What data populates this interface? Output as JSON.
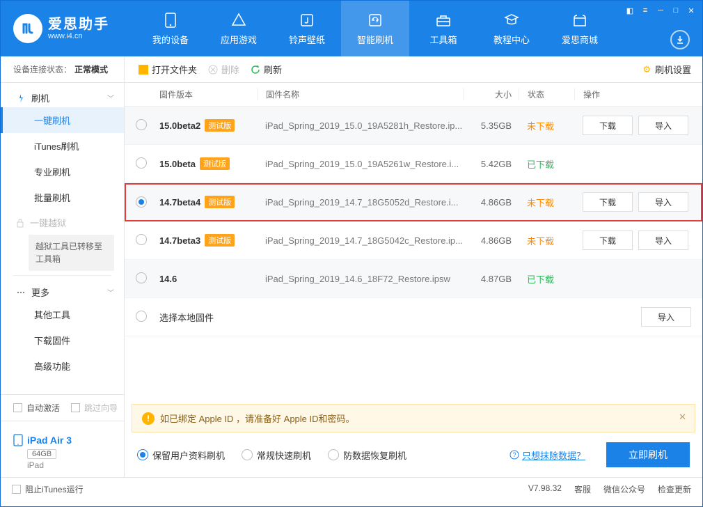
{
  "brand": {
    "name": "爱思助手",
    "url": "www.i4.cn"
  },
  "nav": [
    {
      "label": "我的设备"
    },
    {
      "label": "应用游戏"
    },
    {
      "label": "铃声壁纸"
    },
    {
      "label": "智能刷机"
    },
    {
      "label": "工具箱"
    },
    {
      "label": "教程中心"
    },
    {
      "label": "爱思商城"
    }
  ],
  "connection": {
    "prefix": "设备连接状态：",
    "mode": "正常模式"
  },
  "sidebar": {
    "flash_group": "刷机",
    "items": {
      "onekey": "一键刷机",
      "itunes": "iTunes刷机",
      "pro": "专业刷机",
      "batch": "批量刷机",
      "jailbreak": "一键越狱",
      "jailbreak_note": "越狱工具已转移至工具箱",
      "more_group": "更多",
      "other_tools": "其他工具",
      "download_fw": "下载固件",
      "advanced": "高级功能"
    }
  },
  "toolbar": {
    "open": "打开文件夹",
    "delete": "删除",
    "refresh": "刷新",
    "settings": "刷机设置"
  },
  "columns": {
    "version": "固件版本",
    "name": "固件名称",
    "size": "大小",
    "status": "状态",
    "ops": "操作"
  },
  "rows": [
    {
      "version": "15.0beta2",
      "beta": "测试版",
      "name": "iPad_Spring_2019_15.0_19A5281h_Restore.ip...",
      "size": "5.35GB",
      "status": "未下载",
      "status_class": "st-orange",
      "download": "下载",
      "import": "导入",
      "checked": false,
      "alt": true,
      "highlight": false,
      "show_dl": true
    },
    {
      "version": "15.0beta",
      "beta": "测试版",
      "name": "iPad_Spring_2019_15.0_19A5261w_Restore.i...",
      "size": "5.42GB",
      "status": "已下载",
      "status_class": "st-green",
      "download": "",
      "import": "",
      "checked": false,
      "alt": false,
      "highlight": false,
      "show_dl": false
    },
    {
      "version": "14.7beta4",
      "beta": "测试版",
      "name": "iPad_Spring_2019_14.7_18G5052d_Restore.i...",
      "size": "4.86GB",
      "status": "未下载",
      "status_class": "st-orange",
      "download": "下载",
      "import": "导入",
      "checked": true,
      "alt": true,
      "highlight": true,
      "show_dl": true
    },
    {
      "version": "14.7beta3",
      "beta": "测试版",
      "name": "iPad_Spring_2019_14.7_18G5042c_Restore.ip...",
      "size": "4.86GB",
      "status": "未下载",
      "status_class": "st-orange",
      "download": "下载",
      "import": "导入",
      "checked": false,
      "alt": false,
      "highlight": false,
      "show_dl": true
    },
    {
      "version": "14.6",
      "beta": "",
      "name": "iPad_Spring_2019_14.6_18F72_Restore.ipsw",
      "size": "4.87GB",
      "status": "已下载",
      "status_class": "st-green",
      "download": "",
      "import": "",
      "checked": false,
      "alt": true,
      "highlight": false,
      "show_dl": false
    }
  ],
  "local_row": {
    "label": "选择本地固件",
    "import": "导入"
  },
  "notice": "如已绑定 Apple ID ，请准备好 Apple ID和密码。",
  "flash_options": [
    {
      "label": "保留用户资料刷机",
      "checked": true
    },
    {
      "label": "常规快速刷机",
      "checked": false
    },
    {
      "label": "防数据恢复刷机",
      "checked": false
    }
  ],
  "flash_link": "只想抹除数据？",
  "flash_button": "立即刷机",
  "device_panel": {
    "auto_activate": "自动激活",
    "skip_guide": "跳过向导",
    "name": "iPad Air 3",
    "capacity": "64GB",
    "model": "iPad"
  },
  "footer": {
    "block_itunes": "阻止iTunes运行",
    "version": "V7.98.32",
    "service": "客服",
    "wechat": "微信公众号",
    "update": "检查更新"
  }
}
